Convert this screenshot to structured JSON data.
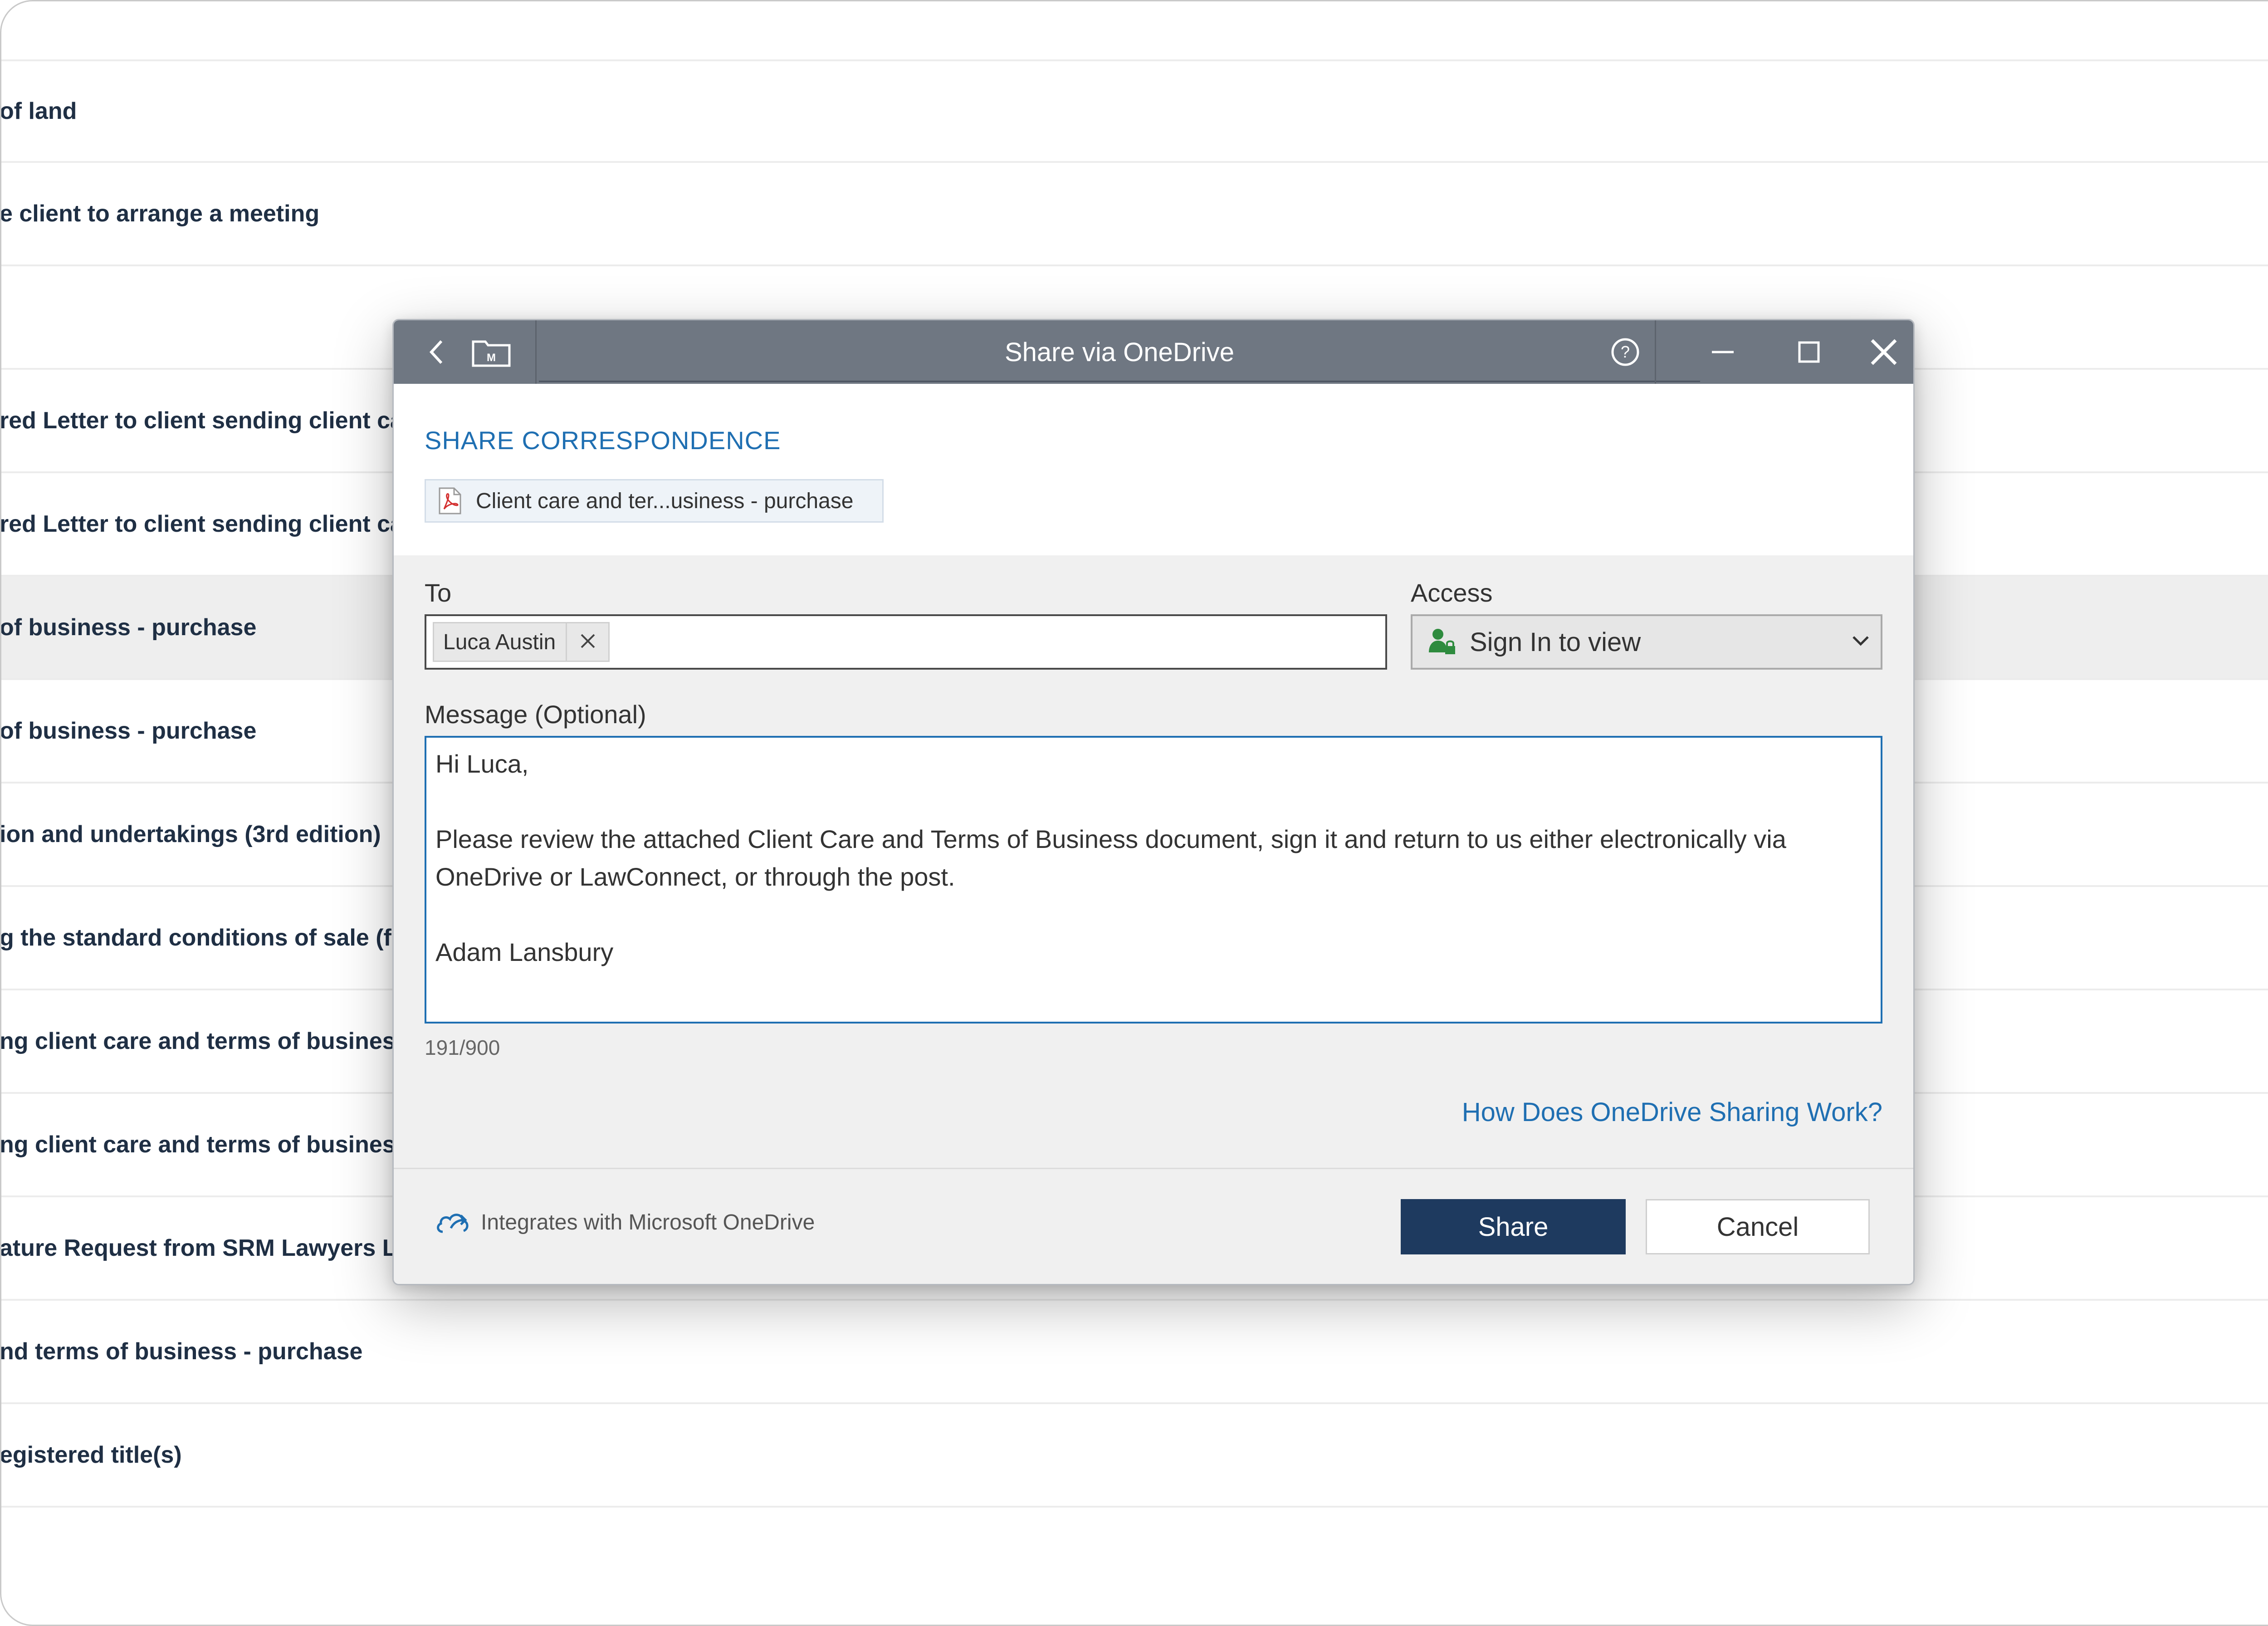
{
  "background_list": {
    "rows": [
      {
        "text": "of land",
        "selected": false
      },
      {
        "text": "e client to arrange a meeting",
        "selected": false
      },
      {
        "text": "",
        "selected": false
      },
      {
        "text": "red Letter to client sending client ca",
        "selected": false
      },
      {
        "text": "red Letter to client sending client ca",
        "selected": false
      },
      {
        "text": " of business - purchase",
        "selected": true
      },
      {
        "text": " of business - purchase",
        "selected": false
      },
      {
        "text": "ion and undertakings (3rd edition)",
        "selected": false
      },
      {
        "text": "g the standard conditions of sale (f",
        "selected": false
      },
      {
        "text": "ng client care and terms of business",
        "selected": false
      },
      {
        "text": "ng client care and terms of business",
        "selected": false
      },
      {
        "text": "ature Request from SRM Lawyers LL",
        "selected": false
      },
      {
        "text": "nd terms of business - purchase",
        "selected": false
      },
      {
        "text": "egistered title(s)",
        "selected": false
      }
    ]
  },
  "dialog": {
    "title": "Share via OneDrive",
    "icons": {
      "back": "chevron-left-icon",
      "matter": "matter-folder-icon",
      "help": "help-circle-icon",
      "minimize": "minimize-icon",
      "maximize": "maximize-icon",
      "close": "close-icon"
    },
    "section_heading": "SHARE CORRESPONDENCE",
    "attachment": {
      "label": "Client care and ter...usiness - purchase",
      "icon": "pdf-file-icon"
    },
    "to": {
      "label": "To",
      "recipients": [
        {
          "name": "Luca Austin"
        }
      ]
    },
    "access": {
      "label": "Access",
      "value": "Sign In to view",
      "icon": "user-lock-icon"
    },
    "message": {
      "label": "Message (Optional)",
      "value": "Hi Luca,\n\nPlease review the attached Client Care and Terms of Business document, sign it and return to us either electronically via\nOneDrive or LawConnect, or through the post.\n\nAdam Lansbury",
      "char_count": "191/900"
    },
    "help_link": "How Does OneDrive Sharing Work?",
    "footer": {
      "integrates_label": "Integrates with Microsoft OneDrive",
      "share_label": "Share",
      "cancel_label": "Cancel"
    },
    "colors": {
      "titlebar": "#6f7782",
      "accent": "#1f6fb2",
      "primary_button": "#1e3a5f",
      "access_icon": "#2e8b3e",
      "pdf_icon": "#d32f2f"
    }
  }
}
